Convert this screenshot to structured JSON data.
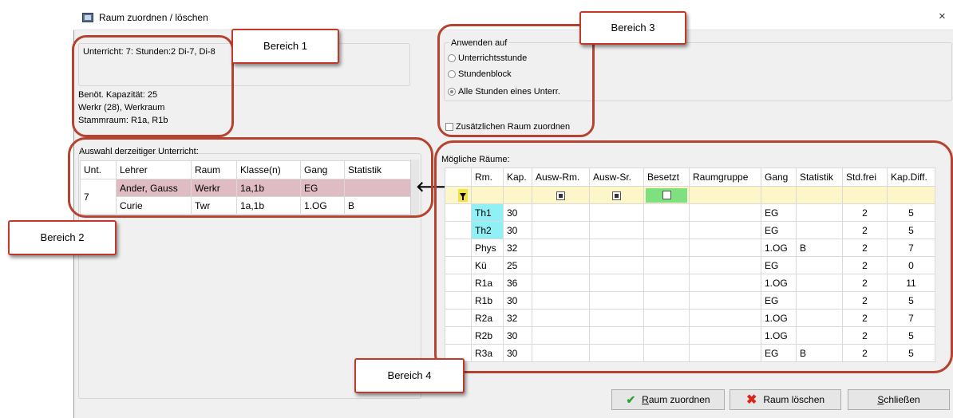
{
  "window": {
    "title": "Raum zuordnen / löschen",
    "close_label": "×"
  },
  "info": {
    "unterricht": "Unterricht: 7: Stunden:2 Di-7, Di-8",
    "kapazitaet": "Benöt. Kapazität: 25",
    "werkraum": "Werkr (28), Werkraum",
    "stammraum": "Stammraum: R1a, R1b"
  },
  "apply": {
    "group_label": "Anwenden auf",
    "options": [
      "Unterrichtsstunde",
      "Stundenblock",
      "Alle Stunden eines Unterr."
    ],
    "selected": "Alle Stunden eines Unterr.",
    "extra_room": "Zusätzlichen Raum zuordnen"
  },
  "current": {
    "label": "Auswahl derzeitiger Unterricht:",
    "headers": [
      "Unt.",
      "Lehrer",
      "Raum",
      "Klasse(n)",
      "Gang",
      "Statistik"
    ],
    "unit": "7",
    "rows": [
      [
        "Ander, Gauss",
        "Werkr",
        "1a,1b",
        "EG",
        ""
      ],
      [
        "Curie",
        "Twr",
        "1a,1b",
        "1.OG",
        "B"
      ]
    ]
  },
  "arrow": "🡐",
  "rooms": {
    "label": "Mögliche Räume:",
    "headers": [
      "Rm.",
      "Kap.",
      "Ausw-Rm.",
      "Ausw-Sr.",
      "Besetzt",
      "Raumgruppe",
      "Gang",
      "Statistik",
      "Std.frei",
      "Kap.Diff."
    ],
    "rows": [
      [
        "Th1",
        "30",
        "",
        "",
        "",
        "",
        "EG",
        "",
        "2",
        "5"
      ],
      [
        "Th2",
        "30",
        "",
        "",
        "",
        "",
        "EG",
        "",
        "2",
        "5"
      ],
      [
        "Phys",
        "32",
        "",
        "",
        "",
        "",
        "1.OG",
        "B",
        "2",
        "7"
      ],
      [
        "Kü",
        "25",
        "",
        "",
        "",
        "",
        "EG",
        "",
        "2",
        "0"
      ],
      [
        "R1a",
        "36",
        "",
        "",
        "",
        "",
        "1.OG",
        "",
        "2",
        "11"
      ],
      [
        "R1b",
        "30",
        "",
        "",
        "",
        "",
        "EG",
        "",
        "2",
        "5"
      ],
      [
        "R2a",
        "32",
        "",
        "",
        "",
        "",
        "1.OG",
        "",
        "2",
        "7"
      ],
      [
        "R2b",
        "30",
        "",
        "",
        "",
        "",
        "1.OG",
        "",
        "2",
        "5"
      ],
      [
        "R3a",
        "30",
        "",
        "",
        "",
        "",
        "EG",
        "B",
        "2",
        "5"
      ]
    ],
    "highlight_color": "#8ff0f5"
  },
  "callouts": {
    "b1": "Bereich 1",
    "b2": "Bereich 2",
    "b3": "Bereich 3",
    "b4": "Bereich 4"
  },
  "buttons": {
    "assign_prefix": "R",
    "assign_rest": "aum zuordnen",
    "delete": "Raum löschen",
    "close_prefix": "S",
    "close_rest": "chließen"
  }
}
